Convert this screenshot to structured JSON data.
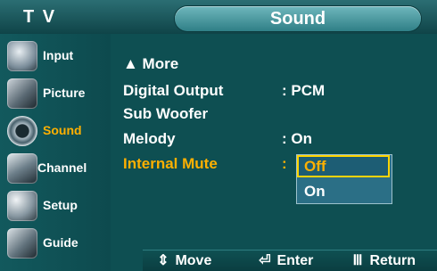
{
  "header": {
    "left_label": "T V",
    "title": "Sound"
  },
  "sidebar": {
    "items": [
      {
        "label": "Input",
        "icon": "input-icon",
        "active": false
      },
      {
        "label": "Picture",
        "icon": "picture-icon",
        "active": false
      },
      {
        "label": "Sound",
        "icon": "sound-icon",
        "active": true
      },
      {
        "label": "Channel",
        "icon": "channel-icon",
        "active": false
      },
      {
        "label": "Setup",
        "icon": "setup-icon",
        "active": false
      },
      {
        "label": "Guide",
        "icon": "guide-icon",
        "active": false
      }
    ]
  },
  "menu": {
    "more_label": "▲ More",
    "items": [
      {
        "label": "Digital Output",
        "value": ": PCM"
      },
      {
        "label": "Sub Woofer",
        "value": ""
      },
      {
        "label": "Melody",
        "value": ": On"
      },
      {
        "label": "Internal Mute",
        "value": ":"
      }
    ]
  },
  "dropdown": {
    "options": [
      "Off",
      "On"
    ],
    "selected": "Off"
  },
  "footer": {
    "move": "Move",
    "enter": "Enter",
    "return": "Return"
  },
  "colors": {
    "accent": "#ffb000",
    "highlight_border": "#ffd400",
    "bg": "#0e4f52"
  }
}
